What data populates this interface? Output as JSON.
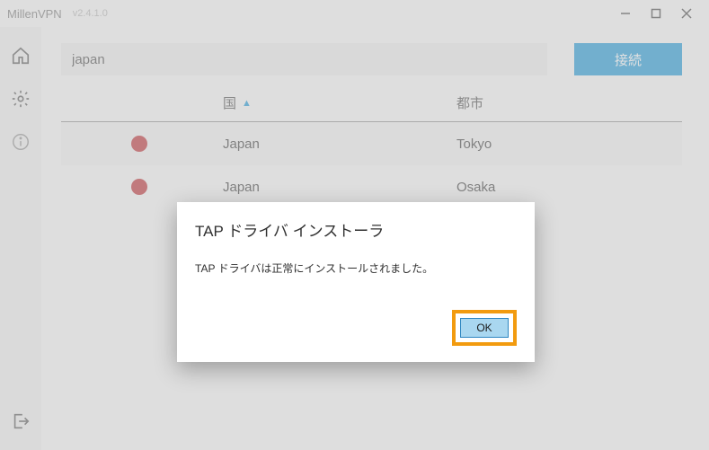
{
  "titlebar": {
    "app_name": "MillenVPN",
    "version": "v2.4.1.0"
  },
  "search": {
    "value": "japan"
  },
  "connect_label": "接続",
  "table": {
    "header_country": "国",
    "header_city": "都市",
    "rows": [
      {
        "country": "Japan",
        "city": "Tokyo"
      },
      {
        "country": "Japan",
        "city": "Osaka"
      }
    ]
  },
  "dialog": {
    "title": "TAP ドライバ インストーラ",
    "message": "TAP ドライバは正常にインストールされました。",
    "ok_label": "OK"
  }
}
